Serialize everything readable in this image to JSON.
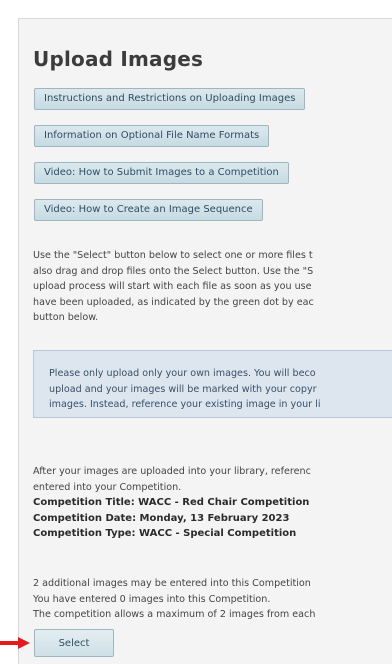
{
  "page": {
    "title": "Upload Images"
  },
  "buttons": {
    "instructions": "Instructions and Restrictions on Uploading Images",
    "file_name_formats": "Information on Optional File Name Formats",
    "video_submit": "Video: How to Submit Images to a Competition",
    "video_sequence": "Video: How to Create an Image Sequence",
    "select": "Select"
  },
  "intro_lines": [
    "Use the \"Select\" button below to select one or more files t",
    "also drag and drop files onto the Select button. Use the \"S",
    "upload process will start with each file as soon as you use",
    "have been uploaded, as indicated by the green dot by eac",
    "button below."
  ],
  "notice_lines": [
    "Please only upload only your own images. You will beco",
    "upload and your images will be marked with your copyr",
    "images. Instead, reference your existing image in your li"
  ],
  "library_lines": [
    "After your images are uploaded into your library, referenc",
    "entered into your Competition."
  ],
  "competition": {
    "title": "Competition Title: WACC - Red Chair Competition",
    "date": "Competition Date: Monday, 13 February 2023",
    "type": "Competition Type: WACC - Special Competition"
  },
  "count_lines": [
    "2 additional images may be entered into this Competition",
    "You have entered 0 images into this Competition.",
    "The competition allows a maximum of 2 images from each"
  ],
  "colors": {
    "arrow": "#e8191b",
    "button_text": "#2f4d62",
    "notice_bg": "#dde6ee"
  },
  "icons": {
    "pointer": "red-arrow-icon"
  }
}
